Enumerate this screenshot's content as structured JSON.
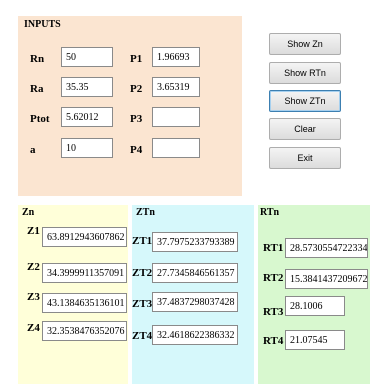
{
  "inputs": {
    "title": "INPUTS",
    "rn_label": "Rn",
    "rn_value": "50",
    "ra_label": "Ra",
    "ra_value": "35.35",
    "ptot_label": "Ptot",
    "ptot_value": "5.62012",
    "a_label": "a",
    "a_value": "10",
    "p1_label": "P1",
    "p1_value": "1.96693",
    "p2_label": "P2",
    "p2_value": "3.65319",
    "p3_label": "P3",
    "p3_value": "",
    "p4_label": "P4",
    "p4_value": ""
  },
  "buttons": {
    "show_zn": "Show Zn",
    "show_rtn": "Show RTn",
    "show_ztn": "Show ZTn",
    "clear": "Clear",
    "exit": "Exit"
  },
  "zn": {
    "title": "Zn",
    "z1_label": "Z1",
    "z1_value": "63.8912943607862",
    "z2_label": "Z2",
    "z2_value": "34.3999911357091",
    "z3_label": "Z3",
    "z3_value": "43.1384635136101",
    "z4_label": "Z4",
    "z4_value": "32.3538476352076"
  },
  "ztn": {
    "title": "ZTn",
    "zt1_label": "ZT1",
    "zt1_value": "37.7975233793389",
    "zt2_label": "ZT2",
    "zt2_value": "27.7345846561357",
    "zt3_label": "ZT3",
    "zt3_value": "37.4837298037428",
    "zt4_label": "ZT4",
    "zt4_value": "32.4618622386332"
  },
  "rtn": {
    "title": "RTn",
    "rt1_label": "RT1",
    "rt1_value": "28.5730554722334",
    "rt2_label": "RT2",
    "rt2_value": "15.3841437209672",
    "rt3_label": "RT3",
    "rt3_value": "28.1006",
    "rt4_label": "RT4",
    "rt4_value": "21.07545"
  },
  "colors": {
    "inputs_bg": "#fbe5d1",
    "zn_bg": "#ffffd9",
    "ztn_bg": "#d6f8fb",
    "rtn_bg": "#d8f8cf"
  }
}
